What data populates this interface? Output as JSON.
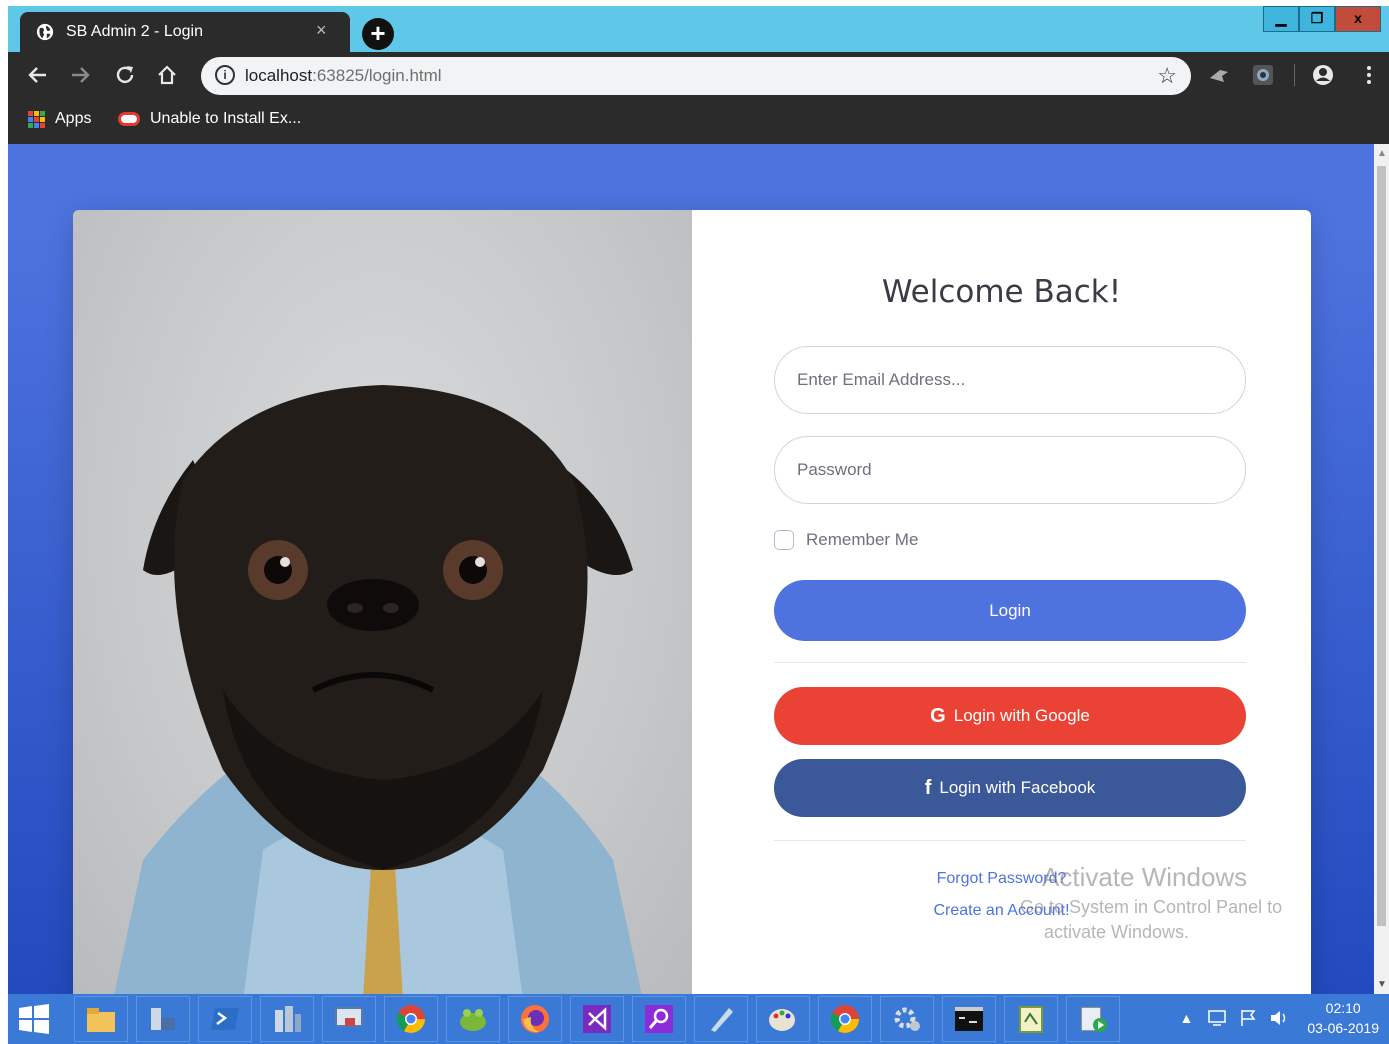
{
  "browser": {
    "tab_title": "SB Admin 2 - Login",
    "tab_close": "×",
    "new_tab": "+",
    "window_buttons": {
      "minimize": "▁",
      "restore": "❐",
      "close": "x"
    },
    "url_host": "localhost",
    "url_rest": ":63825/login.html",
    "info": "i",
    "star": "☆"
  },
  "bookmarks": {
    "apps_label": "Apps",
    "item1_label": "Unable to Install Ex..."
  },
  "login": {
    "heading": "Welcome Back!",
    "email_placeholder": "Enter Email Address...",
    "password_placeholder": "Password",
    "remember_label": "Remember Me",
    "login_button": "Login",
    "google_icon": "G",
    "google_button": "Login with Google",
    "facebook_icon": "f",
    "facebook_button": "Login with Facebook",
    "forgot_link": "Forgot Password?",
    "create_link": "Create an Account!"
  },
  "watermark": {
    "line1": "Activate Windows",
    "line2": "Go to System in Control Panel to",
    "line3": "activate Windows."
  },
  "taskbar": {
    "time": "02:10",
    "date": "03-06-2019"
  },
  "colors": {
    "primary": "#4e73df",
    "google": "#ea4335",
    "facebook": "#3b5998"
  }
}
